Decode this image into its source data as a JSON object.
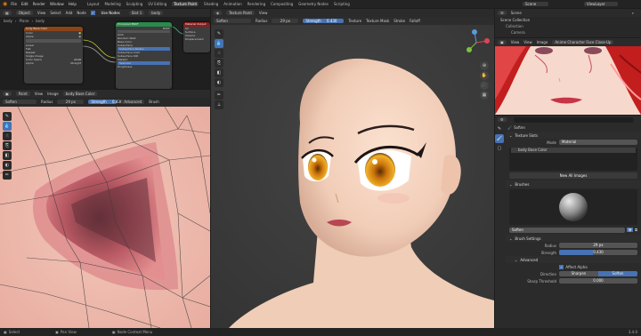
{
  "menubar": {
    "menu": [
      "File",
      "Edit",
      "Render",
      "Window",
      "Help"
    ],
    "workspaces": [
      "Layout",
      "Modeling",
      "Sculpting",
      "UV Editing",
      "Texture Paint",
      "Shading",
      "Animation",
      "Rendering",
      "Compositing",
      "Geometry Nodes",
      "Scripting"
    ],
    "active_workspace": "Texture Paint",
    "scene": "Scene",
    "view_layer": "ViewLayer"
  },
  "node_editor": {
    "header": [
      "Object",
      "View",
      "Select",
      "Add",
      "Node"
    ],
    "use_nodes": "Use Nodes",
    "slot": "Slot 1",
    "material": "body",
    "breadcrumb": [
      "body",
      "Plane",
      "body"
    ],
    "node1_title": "body Base Color",
    "node2_title": "Principled BSDF",
    "node3_title": "Material Output",
    "node1_rows": [
      "Color",
      "Alpha",
      "Linear",
      "Flat",
      "Repeat",
      "Single Image",
      "Color Space",
      "sRGB",
      "Alpha",
      "Straight"
    ],
    "node2_rows": [
      "BSDF",
      "GGX",
      "Random Walk",
      "Base Color",
      "Subsurface",
      "Subsurface Radius",
      "Subsurface Color",
      "Subsurface IOR",
      "Metallic",
      "Specular",
      "Roughness"
    ],
    "node3_rows": [
      "All",
      "Surface",
      "Volume",
      "Displacement"
    ]
  },
  "image_editor": {
    "header": [
      "Paint",
      "View",
      "Image"
    ],
    "image": "body Base Color",
    "brush": "Soften",
    "radius_label": "Radius",
    "radius": "29 px",
    "strength_label": "Strength",
    "strength": "0.430",
    "advanced": "Advanced",
    "brush_menu": "Brush"
  },
  "viewport": {
    "header": [
      "Texture Paint",
      "View"
    ],
    "brush": "Soften",
    "radius_label": "Radius",
    "radius": "29 px",
    "strength_label": "Strength",
    "strength": "0.430",
    "texture": "Texture",
    "texture_mask": "Texture Mask",
    "stroke": "Stroke",
    "falloff": "Falloff"
  },
  "outliner": {
    "title": "Scene",
    "items": [
      "Scene Collection",
      "Collection",
      "Camera"
    ]
  },
  "preview": {
    "header": [
      "View",
      "View",
      "Image"
    ],
    "image_name": "Anime Character Face Close-Up"
  },
  "properties": {
    "brush_title": "Soften",
    "texture_slots": "Texture Slots",
    "mode_label": "Mode",
    "mode": "Material",
    "slot": "body Base Color",
    "new_images": "New All Images",
    "brushes": "Brushes",
    "brush_name": "Soften",
    "brush_settings": "Brush Settings",
    "radius_label": "Radius",
    "radius": "29 px",
    "strength_label": "Strength",
    "strength": "0.430",
    "advanced": "Advanced",
    "affect_alpha": "Affect Alpha",
    "direction_label": "Direction",
    "sharpen": "Sharpen",
    "soften": "Soften",
    "sharp_threshold_label": "Sharp Threshold",
    "sharp_threshold": "0.000",
    "strength_fraction": 0.43
  },
  "statusbar": {
    "left": "Select",
    "middle": "Pan View",
    "context": "Node Context Menu",
    "version": "3.4.0"
  },
  "colors": {
    "accent": "#4772b3",
    "bg": "#1d1d1d",
    "panel": "#303030",
    "header": "#2b2b2b"
  }
}
